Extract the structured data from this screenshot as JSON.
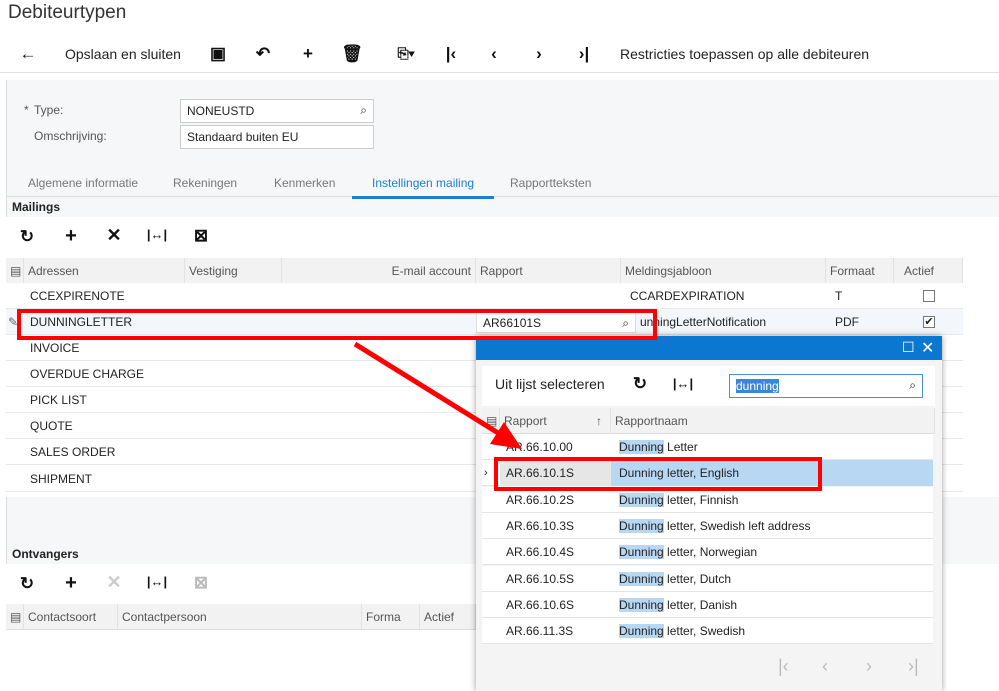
{
  "title": "Debiteurtypen",
  "toolbar": {
    "save_close": "Opslaan en sluiten",
    "restrict": "Restricties toepassen op alle debiteuren"
  },
  "form": {
    "type_label": "Type:",
    "type_value": "NONEUSTD",
    "desc_label": "Omschrijving:",
    "desc_value": "Standaard buiten EU"
  },
  "tabs": [
    "Algemene informatie",
    "Rekeningen",
    "Kenmerken",
    "Instellingen mailing",
    "Rapportteksten"
  ],
  "active_tab": "Instellingen mailing",
  "mailings": {
    "title": "Mailings",
    "columns": [
      "Adressen",
      "Vestiging",
      "E-mail account",
      "Rapport",
      "Meldingsjabloon",
      "Formaat",
      "Actief"
    ],
    "rows": [
      {
        "addr": "CCEXPIRENOTE",
        "report": "",
        "template": "CCARDEXPIRATION",
        "format": "T",
        "active": false
      },
      {
        "addr": "DUNNINGLETTER",
        "report": "AR66101S",
        "template": "unningLetterNotification",
        "format": "PDF",
        "active": true
      },
      {
        "addr": "INVOICE"
      },
      {
        "addr": "OVERDUE CHARGE"
      },
      {
        "addr": "PICK LIST"
      },
      {
        "addr": "QUOTE"
      },
      {
        "addr": "SALES ORDER"
      },
      {
        "addr": "SHIPMENT"
      }
    ]
  },
  "recipients": {
    "title": "Ontvangers",
    "columns": [
      "Contactsoort",
      "Contactpersoon",
      "Forma",
      "Actief"
    ]
  },
  "popup": {
    "title": "Uit lijst selecteren",
    "search": "dunning",
    "columns": [
      "Rapport",
      "Rapportnaam"
    ],
    "rows": [
      {
        "id": "AR.66.10.00",
        "hl": "Dunning",
        "rest": " Letter"
      },
      {
        "id": "AR.66.10.1S",
        "hl": "Dunning",
        "rest": " letter, English"
      },
      {
        "id": "AR.66.10.2S",
        "hl": "Dunning",
        "rest": " letter, Finnish"
      },
      {
        "id": "AR.66.10.3S",
        "hl": "Dunning",
        "rest": " letter, Swedish left address"
      },
      {
        "id": "AR.66.10.4S",
        "hl": "Dunning",
        "rest": " letter, Norwegian"
      },
      {
        "id": "AR.66.10.5S",
        "hl": "Dunning",
        "rest": " letter, Dutch"
      },
      {
        "id": "AR.66.10.6S",
        "hl": "Dunning",
        "rest": " letter, Danish"
      },
      {
        "id": "AR.66.11.3S",
        "hl": "Dunning",
        "rest": " letter, Swedish"
      }
    ],
    "selected_index": 1
  },
  "colors": {
    "accent": "#1c7ed6",
    "popup_header": "#0a78d0",
    "highlight": "#f00"
  }
}
